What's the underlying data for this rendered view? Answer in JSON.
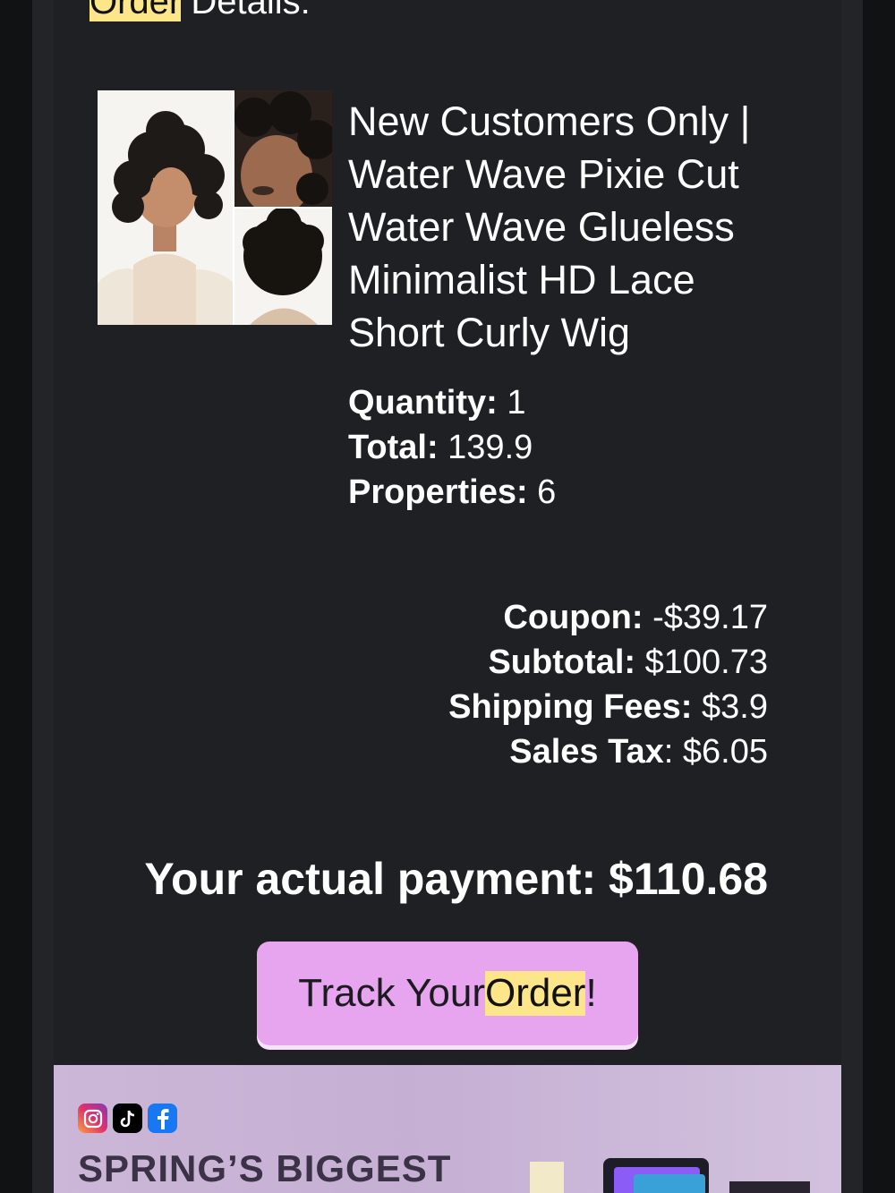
{
  "heading": {
    "highlight": "Order",
    "rest": " Details:"
  },
  "product": {
    "name": "New Customers Only | Water Wave Pixie Cut Water Wave Glueless Minimalist HD Lace Short Curly Wig",
    "image_icon": "product-photo-icon"
  },
  "details": {
    "quantity_label": "Quantity:",
    "quantity_value": " 1",
    "total_label": "Total:",
    "total_value": " 139.9",
    "properties_label": "Properties:",
    "properties_value": " 6"
  },
  "summary": {
    "coupon_label": "Coupon:",
    "coupon_value": " -$39.17",
    "subtotal_label": "Subtotal:",
    "subtotal_value": " $100.73",
    "shipping_label": "Shipping Fees:",
    "shipping_value": " $3.9",
    "tax_label": "Sales Tax",
    "tax_value": ": $6.05"
  },
  "payment": {
    "text": "Your actual payment: $110.68"
  },
  "track_button": {
    "before": "Track Your ",
    "highlight": "Order",
    "after": "!"
  },
  "banner": {
    "title": "SPRING’S BIGGEST",
    "social_icons": [
      "instagram-icon",
      "tiktok-icon",
      "facebook-icon"
    ]
  },
  "colors": {
    "background": "#1f2024",
    "button": "#e7a4ef",
    "highlight": "#fde68a",
    "banner": "#cdb7d8"
  }
}
